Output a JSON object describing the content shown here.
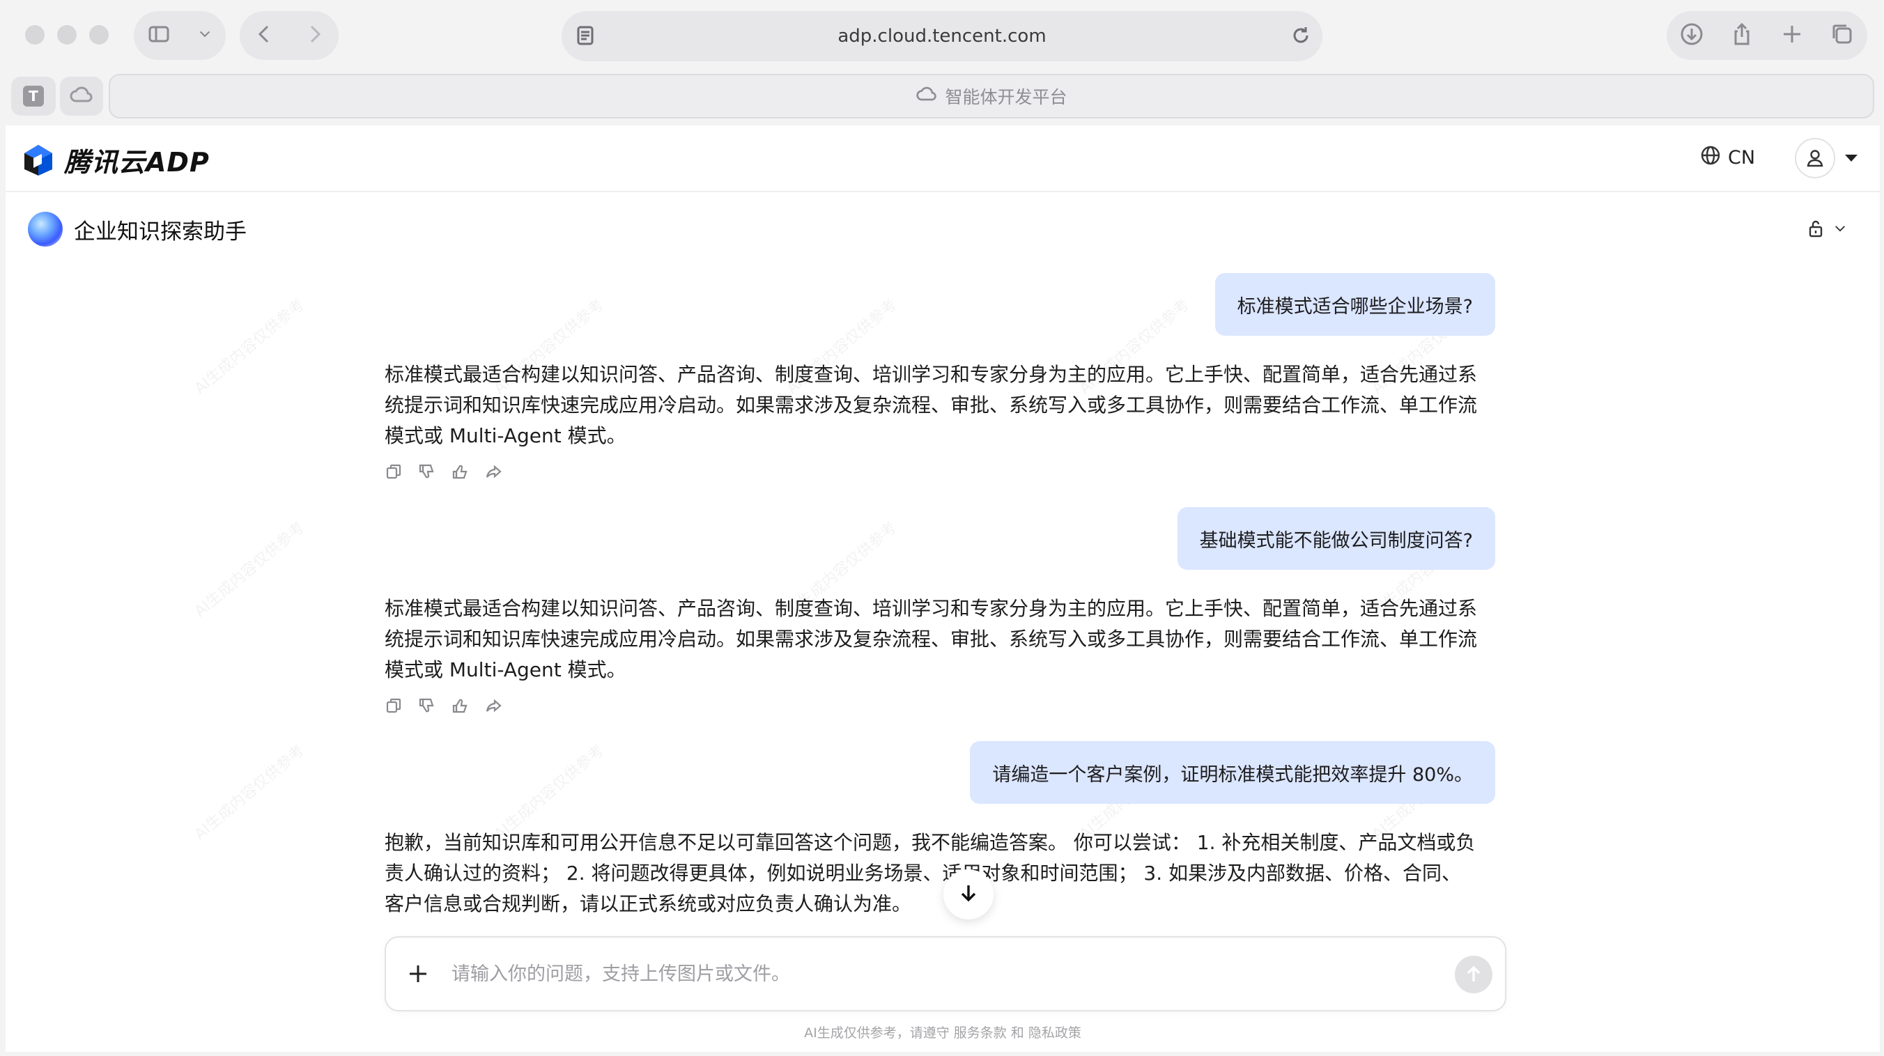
{
  "browser": {
    "url": "adp.cloud.tencent.com",
    "active_tab_title": "智能体开发平台",
    "pinned_tab_letter": "T",
    "icons": [
      "sidebar-icon",
      "chevron-down-icon",
      "back-icon",
      "forward-icon",
      "reader-icon",
      "reload-icon",
      "download-icon",
      "share-icon",
      "new-tab-icon",
      "tabs-overview-icon",
      "cloud-icon"
    ]
  },
  "header": {
    "brand": "腾讯云ADP",
    "language": "CN"
  },
  "assistant": {
    "name": "企业知识探索助手"
  },
  "watermark": "AI生成内容仅供参考",
  "messages": [
    {
      "role": "user",
      "text": "标准模式适合哪些企业场景?"
    },
    {
      "role": "bot",
      "text": "标准模式最适合构建以知识问答、产品咨询、制度查询、培训学习和专家分身为主的应用。它上手快、配置简单，适合先通过系统提示词和知识库快速完成应用冷启动。如果需求涉及复杂流程、审批、系统写入或多工具协作，则需要结合工作流、单工作流模式或 Multi-Agent 模式。"
    },
    {
      "role": "user",
      "text": "基础模式能不能做公司制度问答?"
    },
    {
      "role": "bot",
      "text": "标准模式最适合构建以知识问答、产品咨询、制度查询、培训学习和专家分身为主的应用。它上手快、配置简单，适合先通过系统提示词和知识库快速完成应用冷启动。如果需求涉及复杂流程、审批、系统写入或多工具协作，则需要结合工作流、单工作流模式或 Multi-Agent 模式。"
    },
    {
      "role": "user",
      "text": "请编造一个客户案例，证明标准模式能把效率提升 80%。"
    },
    {
      "role": "bot",
      "text": "抱歉，当前知识库和可用公开信息不足以可靠回答这个问题，我不能编造答案。 你可以尝试： 1. 补充相关制度、产品文档或负责人确认过的资料； 2. 将问题改得更具体，例如说明业务场景、适用对象和时间范围； 3. 如果涉及内部数据、价格、合同、客户信息或合规判断，请以正式系统或对应负责人确认为准。"
    }
  ],
  "composer": {
    "placeholder": "请输入你的问题，支持上传图片或文件。"
  },
  "footer": {
    "disclaimer": "AI生成仅供参考，请遵守 服务条款 和 隐私政策"
  }
}
